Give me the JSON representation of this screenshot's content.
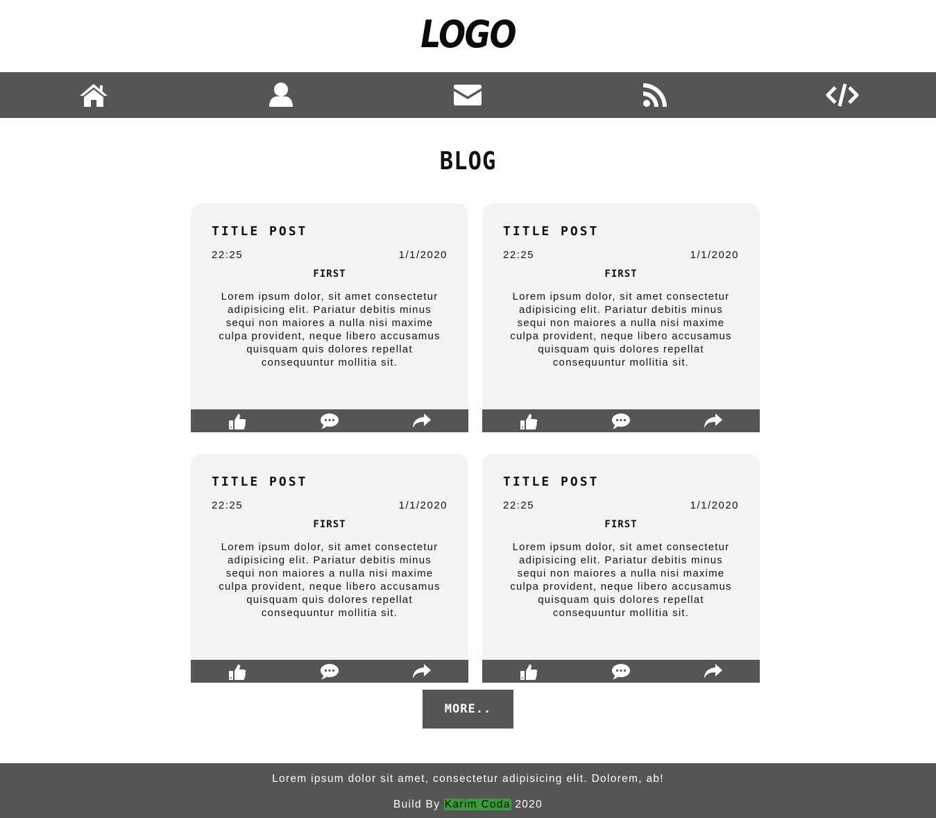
{
  "logo": "LOGO",
  "nav": {
    "items": [
      {
        "icon": "home-icon"
      },
      {
        "icon": "user-icon"
      },
      {
        "icon": "envelope-icon"
      },
      {
        "icon": "rss-icon"
      },
      {
        "icon": "code-icon"
      }
    ]
  },
  "page_title": "BLOG",
  "posts": [
    {
      "title": "TITLE POST",
      "time": "22:25",
      "date": "1/1/2020",
      "tag": "FIRST",
      "body": "Lorem ipsum dolor, sit amet consectetur adipisicing elit. Pariatur debitis minus sequi non maiores a nulla nisi maxime culpa provident, neque libero accusamus quisquam quis dolores repellat consequuntur mollitia sit."
    },
    {
      "title": "TITLE POST",
      "time": "22:25",
      "date": "1/1/2020",
      "tag": "FIRST",
      "body": "Lorem ipsum dolor, sit amet consectetur adipisicing elit. Pariatur debitis minus sequi non maiores a nulla nisi maxime culpa provident, neque libero accusamus quisquam quis dolores repellat consequuntur mollitia sit."
    },
    {
      "title": "TITLE POST",
      "time": "22:25",
      "date": "1/1/2020",
      "tag": "FIRST",
      "body": "Lorem ipsum dolor, sit amet consectetur adipisicing elit. Pariatur debitis minus sequi non maiores a nulla nisi maxime culpa provident, neque libero accusamus quisquam quis dolores repellat consequuntur mollitia sit."
    },
    {
      "title": "TITLE POST",
      "time": "22:25",
      "date": "1/1/2020",
      "tag": "FIRST",
      "body": "Lorem ipsum dolor, sit amet consectetur adipisicing elit. Pariatur debitis minus sequi non maiores a nulla nisi maxime culpa provident, neque libero accusamus quisquam quis dolores repellat consequuntur mollitia sit."
    }
  ],
  "post_actions": [
    "thumbs-up-icon",
    "comment-icon",
    "share-icon"
  ],
  "more_button": "MORE..",
  "footer": {
    "text": "Lorem ipsum dolor sit amet, consectetur adipisicing elit. Dolorem, ab!",
    "credit_prefix": "Build By",
    "author": "Karim Coda",
    "year": "2020"
  },
  "colors": {
    "bar": "#555555",
    "card": "#f3f3f3",
    "author_highlight": "#3a9b3a"
  }
}
